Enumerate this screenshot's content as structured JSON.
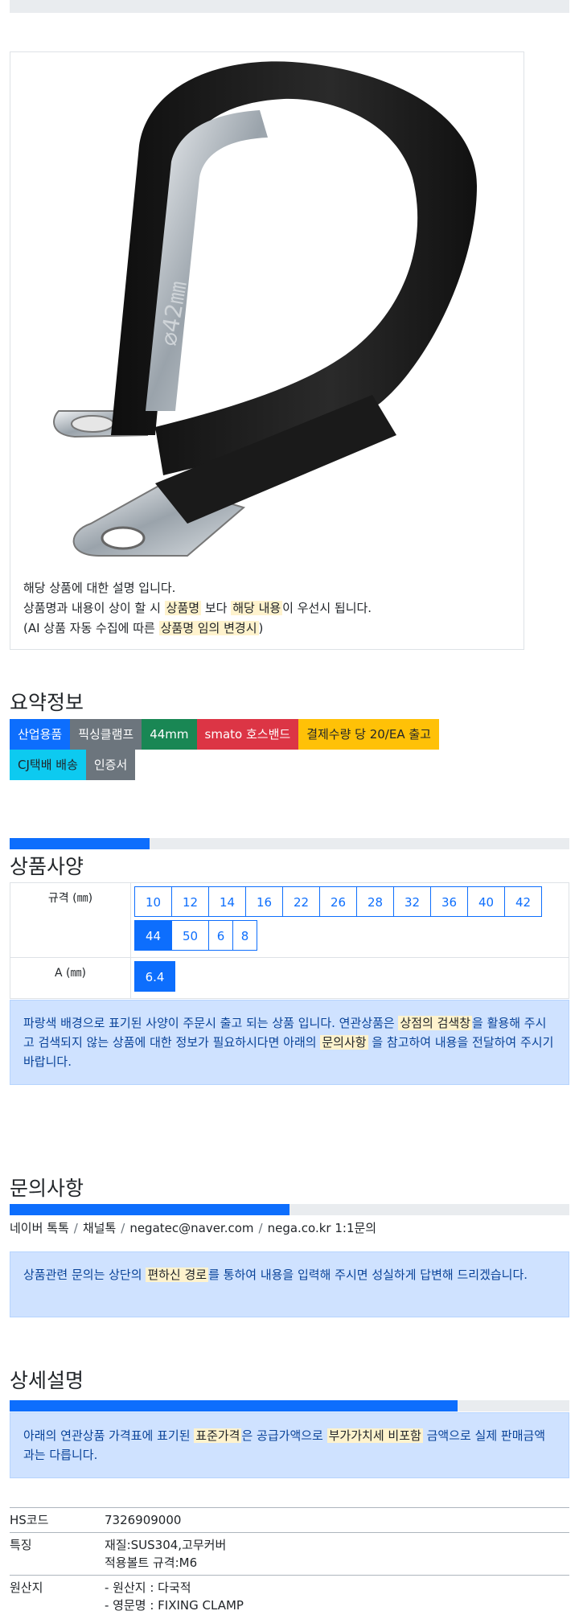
{
  "product": {
    "image_caption": "⌀42㎜",
    "desc_line1": "해당 상품에 대한 설명 입니다.",
    "desc_line2_a": "상품명과 내용이 상이 할 시 ",
    "desc_line2_mark1": "상품명",
    "desc_line2_b": " 보다 ",
    "desc_line2_mark2": "해당 내용",
    "desc_line2_c": "이 우선시 됩니다.",
    "desc_line3_a": "(AI 상품 자동 수집에 따른 ",
    "desc_line3_mark": "상품명 임의 변경시",
    "desc_line3_b": ")"
  },
  "summary": {
    "title": "요약정보",
    "badges_row1": [
      "산업용품",
      "픽싱클램프",
      "44mm",
      "smato 호스밴드",
      "결제수량 당 20/EA 출고"
    ],
    "badges_row2": [
      "CJ택배 배송",
      "인증서"
    ]
  },
  "spec": {
    "progress": 0.25,
    "title": "상품사양",
    "rows": [
      {
        "label": "규격 (㎜)",
        "options": [
          "10",
          "12",
          "14",
          "16",
          "22",
          "26",
          "28",
          "32",
          "36",
          "40",
          "42",
          "44",
          "50",
          "6",
          "8"
        ],
        "selected": "44"
      },
      {
        "label": "A (㎜)",
        "options": [
          "6.4"
        ],
        "selected": "6.4"
      }
    ],
    "notice_a": "파랑색 배경으로 표기된 사양이 주문시 출고 되는 상품 입니다. 연관상품은 ",
    "notice_mark1": "상점의 검색창",
    "notice_b": "을 활용해 주시고 검색되지 않는 상품에 대한 정보가 필요하시다면 아래의 ",
    "notice_mark2": "문의사항",
    "notice_c": " 을 참고하여 내용을 전달하여 주시기 바랍니다."
  },
  "inquiry": {
    "title": "문의사항",
    "progress": 0.5,
    "channels": [
      "네이버 톡톡",
      "채널톡",
      "negatec@naver.com",
      "nega.co.kr 1:1문의"
    ],
    "notice_a": "상품관련 문의는 상단의 ",
    "notice_mark": "편하신 경로",
    "notice_b": "를 통하여 내용을 입력해 주시면 성실하게 답변해 드리겠습니다."
  },
  "detail": {
    "title": "상세설명",
    "progress": 0.8,
    "notice_a": "아래의 연관상품 가격표에 표기된 ",
    "notice_mark1": "표준가격",
    "notice_b": "은 공급가액으로 ",
    "notice_mark2": "부가가치세 비포함",
    "notice_c": " 금액으로 실제 판매금액과는 다릅니다.",
    "rows": [
      {
        "key": "HS코드",
        "values": [
          "7326909000"
        ]
      },
      {
        "key": "특징",
        "values": [
          "재질:SUS304,고무커버",
          "적용볼트 규격:M6"
        ]
      },
      {
        "key": "원산지",
        "values": [
          "- 원산지 : 다국적",
          "- 영문명 : FIXING CLAMP"
        ]
      }
    ]
  },
  "colors": {
    "primary": "#0d6efd",
    "secondary": "#6c757d",
    "success": "#198754",
    "danger": "#dc3545",
    "warning": "#ffc107",
    "info": "#0dcaf0",
    "alert_bg": "#cfe2ff",
    "mark_bg": "#fff3cd"
  }
}
